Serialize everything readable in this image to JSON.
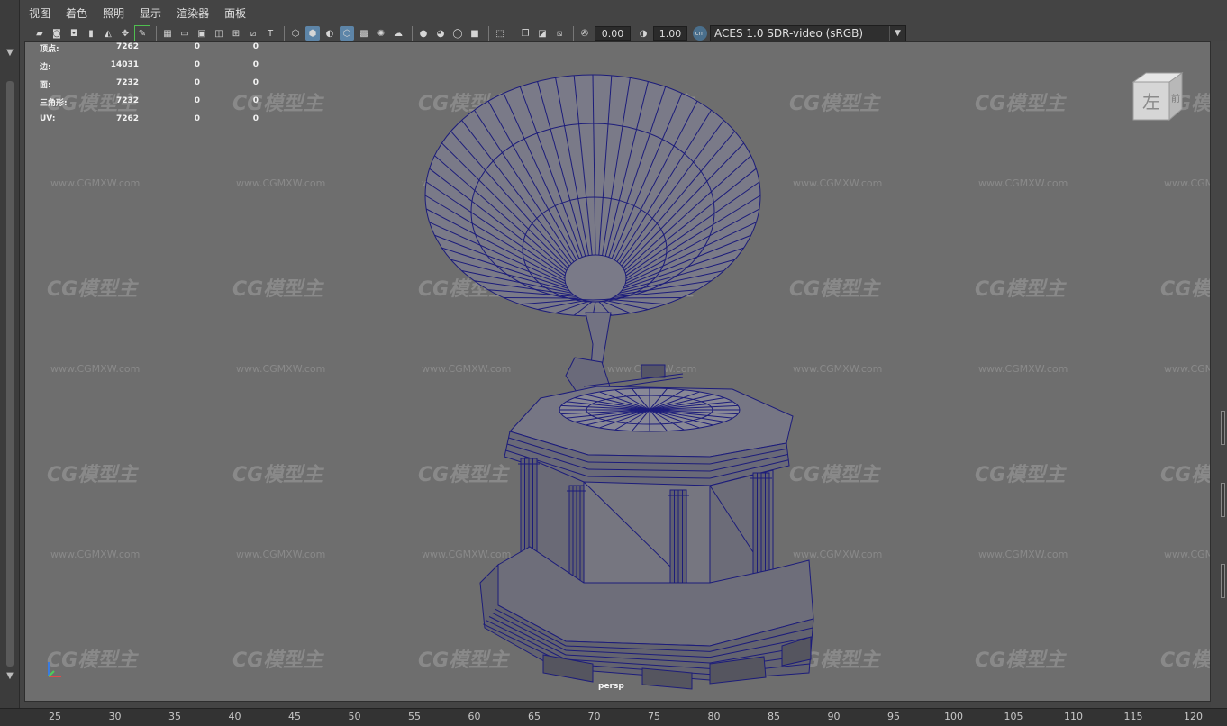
{
  "menu": {
    "items": [
      "视图",
      "着色",
      "照明",
      "显示",
      "渲染器",
      "面板"
    ]
  },
  "toolbar": {
    "exposure_value": "0.00",
    "gamma_value": "1.00",
    "color_space": "ACES 1.0 SDR-video (sRGB)"
  },
  "hud": {
    "rows": [
      {
        "label": "顶点:",
        "v1": "7262",
        "v2": "0",
        "v3": "0"
      },
      {
        "label": "边:",
        "v1": "14031",
        "v2": "0",
        "v3": "0"
      },
      {
        "label": "面:",
        "v1": "7232",
        "v2": "0",
        "v3": "0"
      },
      {
        "label": "三角形:",
        "v1": "7232",
        "v2": "0",
        "v3": "0"
      },
      {
        "label": "UV:",
        "v1": "7262",
        "v2": "0",
        "v3": "0"
      }
    ]
  },
  "viewport": {
    "camera_label": "persp",
    "watermark_text": "CG模型主",
    "watermark_url": "www.CGMXW.com"
  },
  "viewcube": {
    "front_label": "左",
    "side_label": "前"
  },
  "timeline": {
    "ticks": [
      "25",
      "30",
      "35",
      "40",
      "45",
      "50",
      "55",
      "60",
      "65",
      "70",
      "75",
      "80",
      "85",
      "90",
      "95",
      "100",
      "105",
      "110",
      "115",
      "120"
    ]
  },
  "colors": {
    "viewport_bg": "#6e6e6e",
    "wireframe": "#1c1c7a",
    "panel_bg": "#444444",
    "active_icon": "#5d85a8"
  }
}
